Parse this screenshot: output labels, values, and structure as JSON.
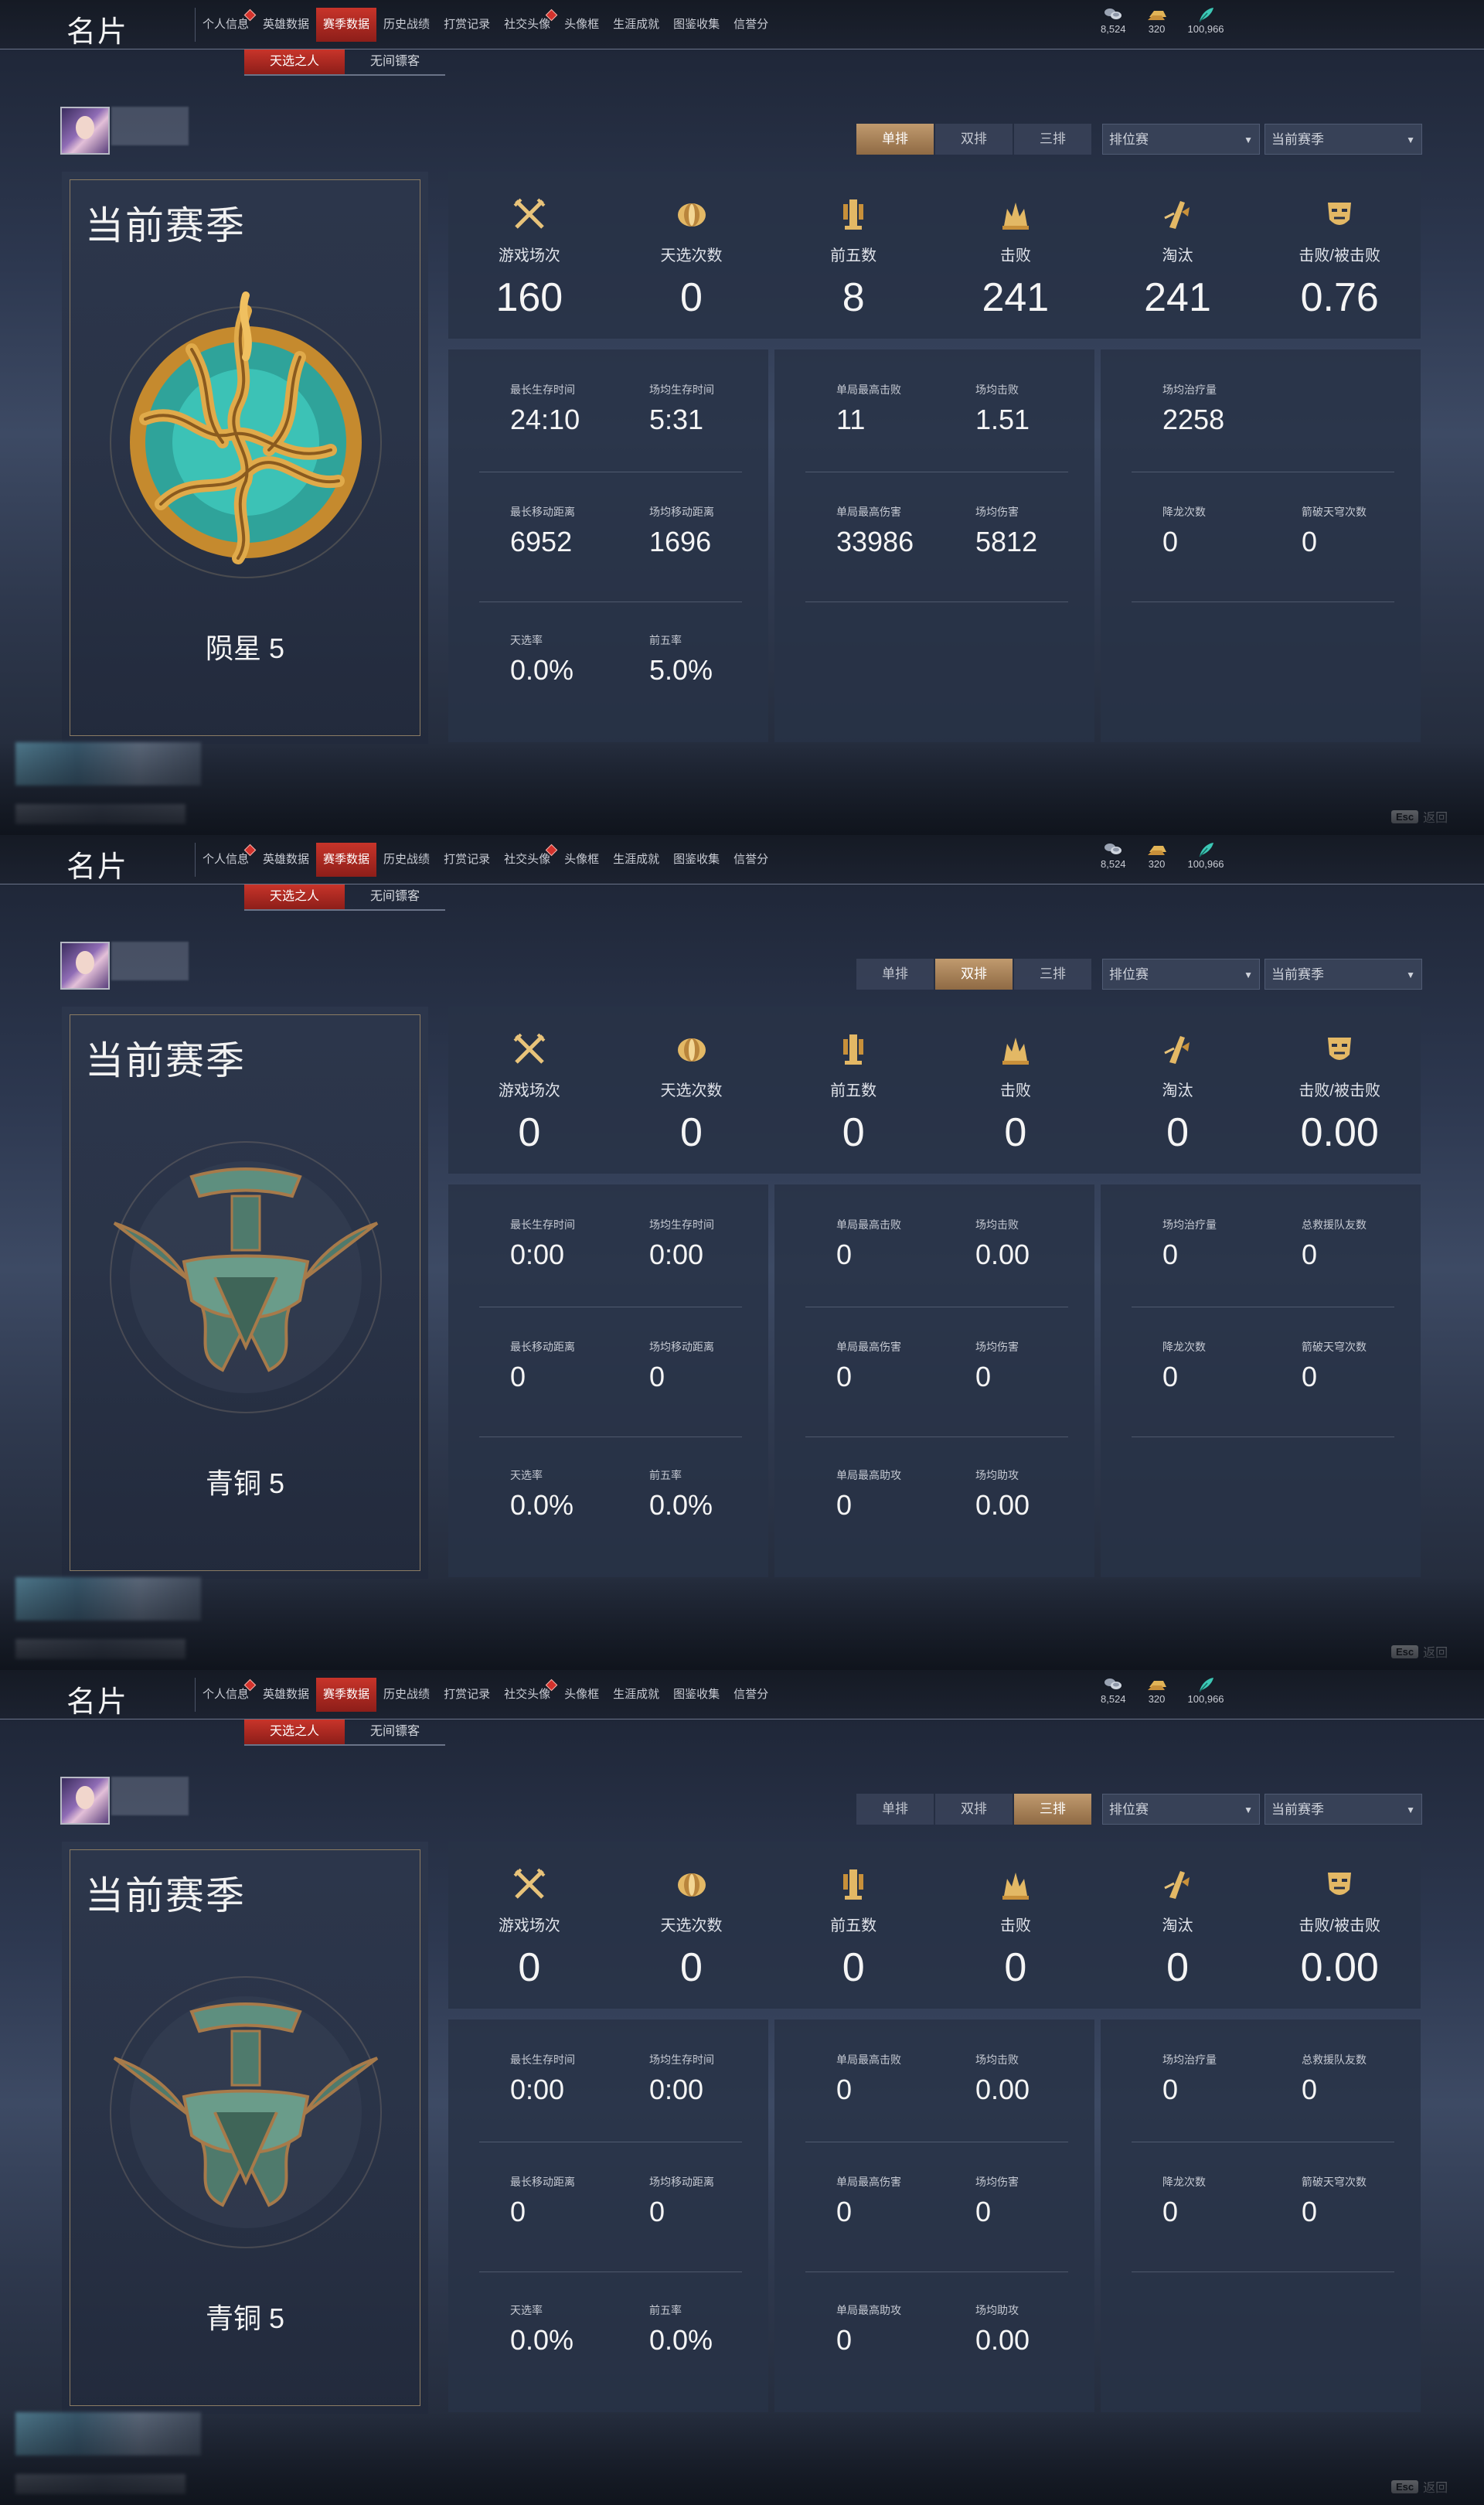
{
  "title": "名片",
  "nav": [
    "个人信息",
    "英雄数据",
    "赛季数据",
    "历史战绩",
    "打赏记录",
    "社交头像",
    "头像框",
    "生涯成就",
    "图鉴收集",
    "信誉分"
  ],
  "currencies": [
    {
      "icon": "coin-stack-icon",
      "value": "8,524"
    },
    {
      "icon": "gold-ingot-icon",
      "value": "320"
    },
    {
      "icon": "feather-icon",
      "value": "100,966"
    }
  ],
  "subtabs": [
    "天选之人",
    "无间镖客"
  ],
  "modes": [
    "单排",
    "双排",
    "三排"
  ],
  "dropdown_mode": "排位赛",
  "dropdown_season": "当前赛季",
  "season_title": "当前赛季",
  "stat_labels": [
    "游戏场次",
    "天选次数",
    "前五数",
    "击败",
    "淘汰",
    "击败/被击败"
  ],
  "esc_key": "Esc",
  "esc_label": "返回",
  "accent_color": "#c8342a",
  "panels": [
    {
      "mode": "单排",
      "rank": "陨星 5",
      "emblem": "meteor-emblem",
      "top": [
        "160",
        "0",
        "8",
        "241",
        "241",
        "0.76"
      ],
      "b1": [
        {
          "l": "最长生存时间",
          "v": "24:10"
        },
        {
          "l": "场均生存时间",
          "v": "5:31"
        },
        {
          "l": "最长移动距离",
          "v": "6952"
        },
        {
          "l": "场均移动距离",
          "v": "1696"
        },
        {
          "l": "天选率",
          "v": "0.0%"
        },
        {
          "l": "前五率",
          "v": "5.0%"
        }
      ],
      "b2": [
        {
          "l": "单局最高击败",
          "v": "11"
        },
        {
          "l": "场均击败",
          "v": "1.51"
        },
        {
          "l": "单局最高伤害",
          "v": "33986"
        },
        {
          "l": "场均伤害",
          "v": "5812"
        },
        {
          "l": "",
          "v": ""
        },
        {
          "l": "",
          "v": ""
        }
      ],
      "b3": [
        {
          "l": "场均治疗量",
          "v": "2258"
        },
        {
          "l": "",
          "v": ""
        },
        {
          "l": "降龙次数",
          "v": "0"
        },
        {
          "l": "箭破天穹次数",
          "v": "0"
        },
        {
          "l": "",
          "v": ""
        },
        {
          "l": "",
          "v": ""
        }
      ]
    },
    {
      "mode": "双排",
      "rank": "青铜 5",
      "emblem": "bronze-emblem",
      "top": [
        "0",
        "0",
        "0",
        "0",
        "0",
        "0.00"
      ],
      "b1": [
        {
          "l": "最长生存时间",
          "v": "0:00"
        },
        {
          "l": "场均生存时间",
          "v": "0:00"
        },
        {
          "l": "最长移动距离",
          "v": "0"
        },
        {
          "l": "场均移动距离",
          "v": "0"
        },
        {
          "l": "天选率",
          "v": "0.0%"
        },
        {
          "l": "前五率",
          "v": "0.0%"
        }
      ],
      "b2": [
        {
          "l": "单局最高击败",
          "v": "0"
        },
        {
          "l": "场均击败",
          "v": "0.00"
        },
        {
          "l": "单局最高伤害",
          "v": "0"
        },
        {
          "l": "场均伤害",
          "v": "0"
        },
        {
          "l": "单局最高助攻",
          "v": "0"
        },
        {
          "l": "场均助攻",
          "v": "0.00"
        }
      ],
      "b3": [
        {
          "l": "场均治疗量",
          "v": "0"
        },
        {
          "l": "总救援队友数",
          "v": "0"
        },
        {
          "l": "降龙次数",
          "v": "0"
        },
        {
          "l": "箭破天穹次数",
          "v": "0"
        },
        {
          "l": "",
          "v": ""
        },
        {
          "l": "",
          "v": ""
        }
      ]
    },
    {
      "mode": "三排",
      "rank": "青铜 5",
      "emblem": "bronze-emblem",
      "top": [
        "0",
        "0",
        "0",
        "0",
        "0",
        "0.00"
      ],
      "b1": [
        {
          "l": "最长生存时间",
          "v": "0:00"
        },
        {
          "l": "场均生存时间",
          "v": "0:00"
        },
        {
          "l": "最长移动距离",
          "v": "0"
        },
        {
          "l": "场均移动距离",
          "v": "0"
        },
        {
          "l": "天选率",
          "v": "0.0%"
        },
        {
          "l": "前五率",
          "v": "0.0%"
        }
      ],
      "b2": [
        {
          "l": "单局最高击败",
          "v": "0"
        },
        {
          "l": "场均击败",
          "v": "0.00"
        },
        {
          "l": "单局最高伤害",
          "v": "0"
        },
        {
          "l": "场均伤害",
          "v": "0"
        },
        {
          "l": "单局最高助攻",
          "v": "0"
        },
        {
          "l": "场均助攻",
          "v": "0.00"
        }
      ],
      "b3": [
        {
          "l": "场均治疗量",
          "v": "0"
        },
        {
          "l": "总救援队友数",
          "v": "0"
        },
        {
          "l": "降龙次数",
          "v": "0"
        },
        {
          "l": "箭破天穹次数",
          "v": "0"
        },
        {
          "l": "",
          "v": ""
        },
        {
          "l": "",
          "v": ""
        }
      ]
    }
  ]
}
